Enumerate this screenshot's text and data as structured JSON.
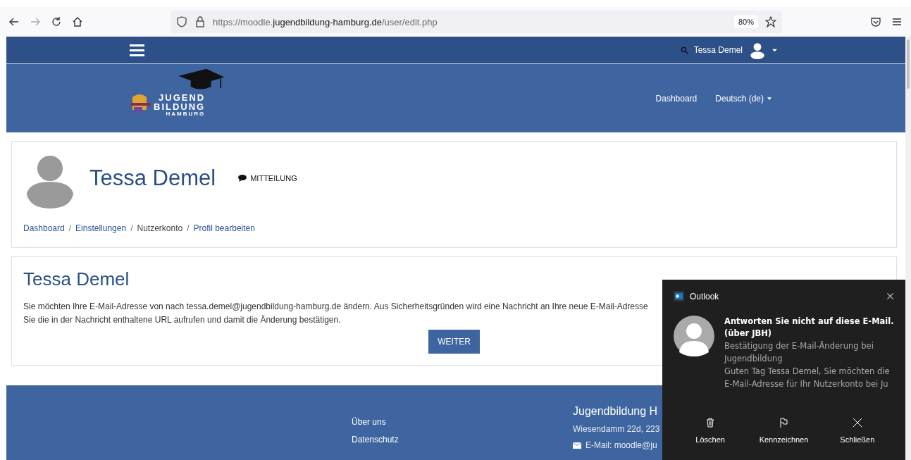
{
  "browser": {
    "url_prefix": "https://moodle.",
    "url_domain": "jugendbildung-hamburg.de",
    "url_path": "/user/edit.php",
    "zoom": "80%"
  },
  "navbar": {
    "user_name": "Tessa Demel"
  },
  "header": {
    "logo_top": "JUGEND",
    "logo_bottom": "BILDUNG",
    "logo_sub": "HAMBURG",
    "links": [
      {
        "label": "Dashboard",
        "dropdown": false
      },
      {
        "label": "Deutsch (de)",
        "dropdown": true
      }
    ]
  },
  "profile": {
    "name": "Tessa Demel",
    "message_label": "MITTEILUNG",
    "separator": "/",
    "breadcrumbs": [
      {
        "label": "Dashboard",
        "link": true
      },
      {
        "label": "Einstellungen",
        "link": true
      },
      {
        "label": "Nutzerkonto",
        "link": false
      },
      {
        "label": "Profil bearbeiten",
        "link": true
      }
    ]
  },
  "notice": {
    "title": "Tessa Demel",
    "lines": [
      "Sie möchten Ihre E-Mail-Adresse von nach tessa.demel@jugendbildung-hamburg.de ändern. Aus Sicherheitsgründen wird eine Nachricht an Ihre neue E-Mail-Adresse",
      "Sie die in der Nachricht enthaltene URL aufrufen und damit die Änderung bestätigen."
    ],
    "button": "WEITER"
  },
  "footer": {
    "links": [
      "Über uns",
      "Datenschutz"
    ],
    "org_title": "Jugendbildung H",
    "address": "Wiesendamm 22d, 223",
    "email": "E-Mail: moodle@ju"
  },
  "toast": {
    "app": "Outlook",
    "sender": "Antworten Sie nicht auf diese E-Mail. (über JBH)",
    "subject": "Bestätigung der E-Mail-Änderung bei Jugendbildung",
    "preview": "Guten Tag Tessa Demel,  Sie möchten die E-Mail-Adresse für Ihr Nutzerkonto bei Ju",
    "actions": [
      {
        "kind": "delete",
        "label": "Löschen"
      },
      {
        "kind": "flag",
        "label": "Kennzeichnen"
      },
      {
        "kind": "close",
        "label": "Schließen"
      }
    ]
  }
}
